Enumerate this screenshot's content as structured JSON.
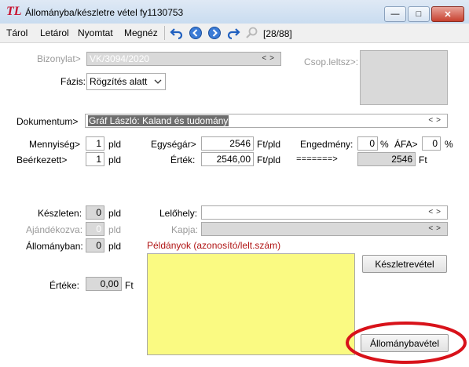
{
  "window": {
    "logo": "TL",
    "title": "Állományba/készletre vétel fy1130753",
    "min": "—",
    "max": "□",
    "close": "✕"
  },
  "menu": {
    "items": [
      "Tárol",
      "Letárol",
      "Nyomtat",
      "Megnéz"
    ],
    "record": "[28/88]"
  },
  "form": {
    "bizonylat_label": "Bizonylat>",
    "bizonylat_value": "VK/3094/2020",
    "csop_label": "Csop.leltsz>:",
    "fazis_label": "Fázis:",
    "fazis_value": "Rögzítés alatt",
    "dokumentum_label": "Dokumentum>",
    "dokumentum_value": "Gráf László: Kaland és tudomány",
    "mennyiseg_label": "Mennyiség>",
    "mennyiseg_value": "1",
    "mennyiseg_unit": "pld",
    "beerkezett_label": "Beérkezett>",
    "beerkezett_value": "1",
    "beerkezett_unit": "pld",
    "egysegar_label": "Egységár>",
    "egysegar_value": "2546",
    "egysegar_unit": "Ft/pld",
    "ertek_label": "Érték:",
    "ertek_value": "2546,00",
    "ertek_unit": "Ft/pld",
    "arrow": "=======>",
    "total_value": "2546",
    "total_unit": "Ft",
    "engedmeny_label": "Engedmény:",
    "engedmeny_value": "0",
    "engedmeny_unit": "%",
    "afa_label": "ÁFA>",
    "afa_value": "0",
    "afa_unit": "%",
    "keszleten_label": "Készleten:",
    "keszleten_value": "0",
    "keszleten_unit": "pld",
    "ajandek_label": "Ajándékozva:",
    "ajandek_value": "0",
    "ajandek_unit": "pld",
    "allomanyban_label": "Állományban:",
    "allomanyban_value": "0",
    "allomanyban_unit": "pld",
    "lelohely_label": "Lelőhely:",
    "kapja_label": "Kapja:",
    "peldanyok_label": "Példányok (azonosító/lelt.szám)",
    "erteke_label": "Értéke:",
    "erteke_value": "0,00",
    "erteke_unit": "Ft",
    "keszletrevetel_btn": "Készletrevétel",
    "allomanybavetel_btn": "Állománybavétel"
  },
  "colors": {
    "yellow_panel": "#fafa82",
    "highlight": "#d8121a"
  }
}
